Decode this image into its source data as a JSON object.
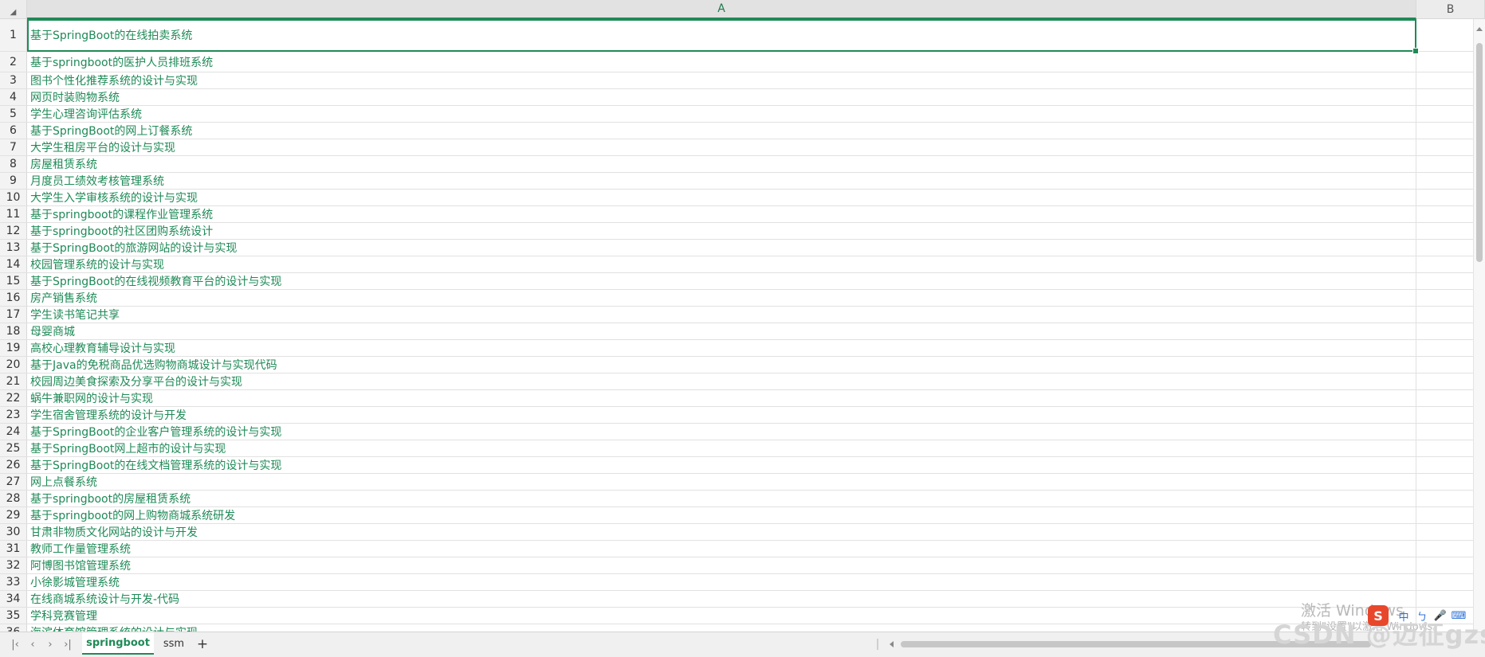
{
  "header": {
    "corner_icon": "select-all-triangle",
    "corner_glyph": "◢",
    "columns": [
      "A",
      "B"
    ]
  },
  "rows": [
    {
      "num": "1",
      "a": "基于SpringBoot的在线拍卖系统"
    },
    {
      "num": "2",
      "a": "基于springboot的医护人员排班系统"
    },
    {
      "num": "3",
      "a": "图书个性化推荐系统的设计与实现"
    },
    {
      "num": "4",
      "a": "网页时装购物系统"
    },
    {
      "num": "5",
      "a": "学生心理咨询评估系统"
    },
    {
      "num": "6",
      "a": "基于SpringBoot的网上订餐系统"
    },
    {
      "num": "7",
      "a": "大学生租房平台的设计与实现"
    },
    {
      "num": "8",
      "a": "房屋租赁系统"
    },
    {
      "num": "9",
      "a": "月度员工绩效考核管理系统"
    },
    {
      "num": "10",
      "a": "大学生入学审核系统的设计与实现"
    },
    {
      "num": "11",
      "a": "基于springboot的课程作业管理系统"
    },
    {
      "num": "12",
      "a": "基于springboot的社区团购系统设计"
    },
    {
      "num": "13",
      "a": "基于SpringBoot的旅游网站的设计与实现"
    },
    {
      "num": "14",
      "a": "校园管理系统的设计与实现"
    },
    {
      "num": "15",
      "a": "基于SpringBoot的在线视频教育平台的设计与实现"
    },
    {
      "num": "16",
      "a": "房产销售系统"
    },
    {
      "num": "17",
      "a": "学生读书笔记共享"
    },
    {
      "num": "18",
      "a": "母婴商城"
    },
    {
      "num": "19",
      "a": "高校心理教育辅导设计与实现"
    },
    {
      "num": "20",
      "a": "基于Java的免税商品优选购物商城设计与实现代码"
    },
    {
      "num": "21",
      "a": "校园周边美食探索及分享平台的设计与实现"
    },
    {
      "num": "22",
      "a": "蜗牛兼职网的设计与实现"
    },
    {
      "num": "23",
      "a": "学生宿舍管理系统的设计与开发"
    },
    {
      "num": "24",
      "a": "基于SpringBoot的企业客户管理系统的设计与实现"
    },
    {
      "num": "25",
      "a": "基于SpringBoot网上超市的设计与实现"
    },
    {
      "num": "26",
      "a": "基于SpringBoot的在线文档管理系统的设计与实现"
    },
    {
      "num": "27",
      "a": "网上点餐系统"
    },
    {
      "num": "28",
      "a": "基于springboot的房屋租赁系统"
    },
    {
      "num": "29",
      "a": "基于springboot的网上购物商城系统研发"
    },
    {
      "num": "30",
      "a": "甘肃非物质文化网站的设计与开发"
    },
    {
      "num": "31",
      "a": "教师工作量管理系统"
    },
    {
      "num": "32",
      "a": "阿博图书馆管理系统"
    },
    {
      "num": "33",
      "a": "小徐影城管理系统"
    },
    {
      "num": "34",
      "a": "在线商城系统设计与开发-代码"
    },
    {
      "num": "35",
      "a": "学科竞赛管理"
    },
    {
      "num": "36",
      "a": "海滨体育馆管理系统的设计与实现"
    }
  ],
  "tabbar": {
    "nav": [
      {
        "name": "first-sheet-button",
        "glyph": "|‹"
      },
      {
        "name": "prev-sheet-button",
        "glyph": "‹"
      },
      {
        "name": "next-sheet-button",
        "glyph": "›"
      },
      {
        "name": "last-sheet-button",
        "glyph": "›|"
      }
    ],
    "tabs": [
      {
        "label": "springboot",
        "active": true
      },
      {
        "label": "ssm",
        "active": false
      }
    ],
    "add_glyph": "+"
  },
  "overlay": {
    "watermark_line1": "激活 Windows",
    "watermark_line2": "转到\"设置\"以激活 Windows。",
    "csdn": "CSDN @迈征gzs",
    "ime": [
      "S",
      "中",
      "ㄅ",
      "🎤",
      "⌨"
    ]
  },
  "colors": {
    "accent": "#1f8a57",
    "header_bg": "#ececec",
    "grid_line": "#e1e1e1"
  }
}
